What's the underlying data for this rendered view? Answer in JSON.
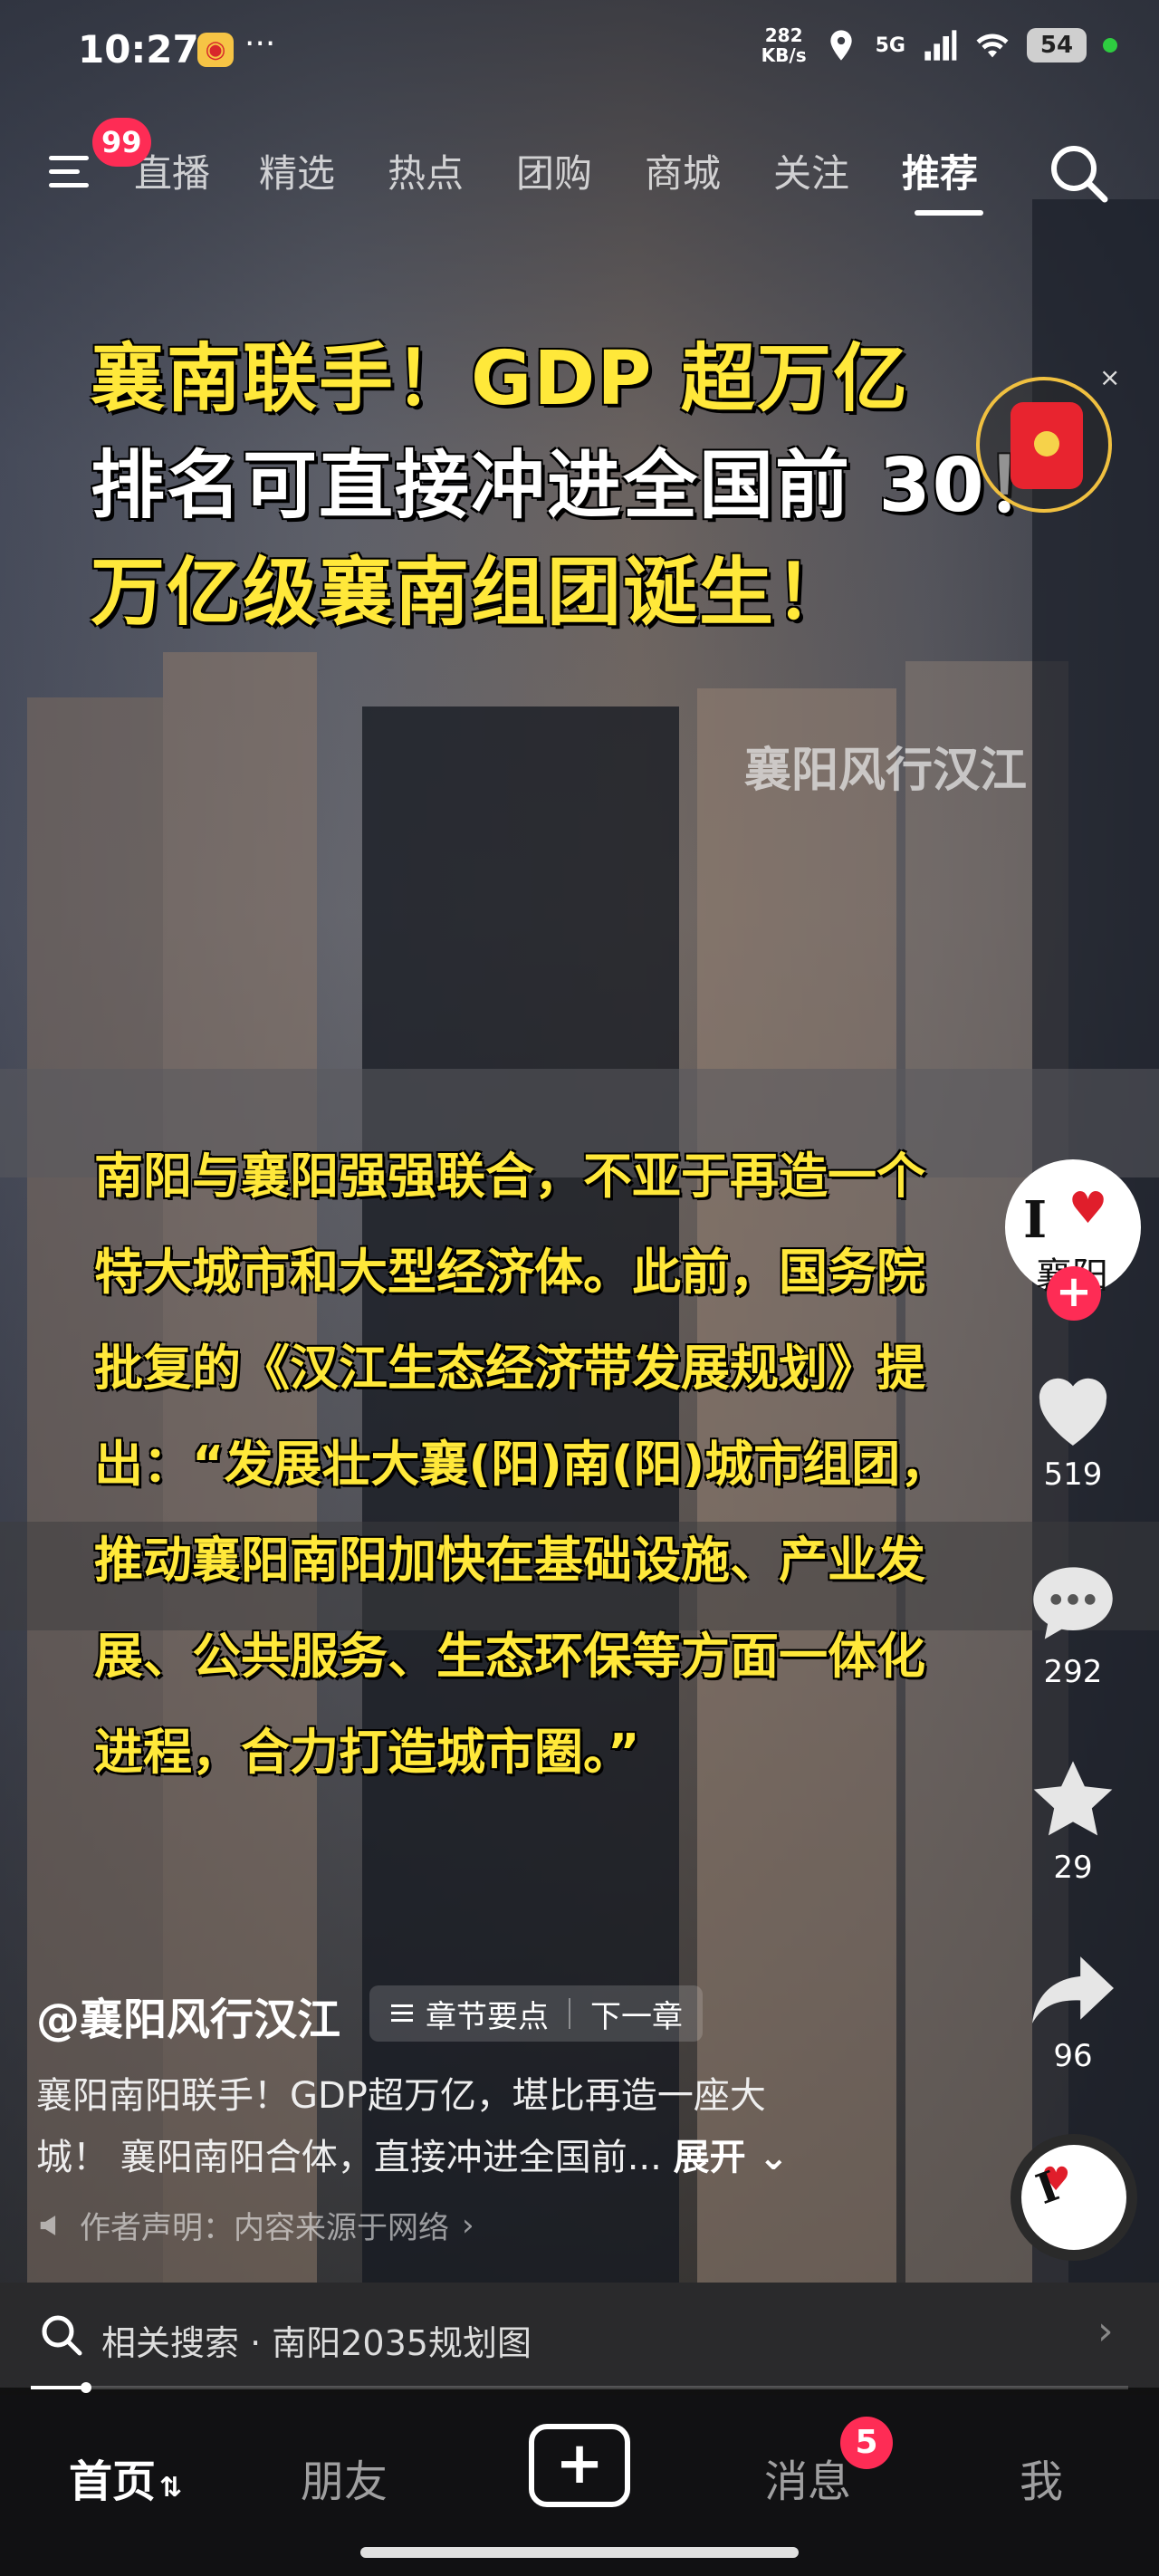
{
  "status_bar": {
    "time": "10:27",
    "dots": "···",
    "net_speed_value": "282",
    "net_speed_unit": "KB/s",
    "signal_label": "5G",
    "battery": "54"
  },
  "top_nav": {
    "menu_badge": "99",
    "tabs": [
      {
        "label": "直播",
        "active": false
      },
      {
        "label": "精选",
        "active": false
      },
      {
        "label": "热点",
        "active": false
      },
      {
        "label": "团购",
        "active": false
      },
      {
        "label": "商城",
        "active": false
      },
      {
        "label": "关注",
        "active": false
      },
      {
        "label": "推荐",
        "active": true
      }
    ]
  },
  "video": {
    "headline_line1": "襄南联手！GDP 超万亿",
    "headline_line2": "排名可直接冲进全国前 30！",
    "headline_line3": "万亿级襄南组团诞生！",
    "watermark": "襄阳风行汉江",
    "red_packet_close": "×",
    "body_lines": [
      "南阳与襄阳强强联合，不亚于再造一个",
      "特大城市和大型经济体。此前，国务院",
      "批复的《汉江生态经济带发展规划》提",
      "出：“发展壮大襄(阳)南(阳)城市组团，",
      "推动襄阳南阳加快在基础设施、产业发",
      "展、公共服务、生态环保等方面一体化",
      "进程，合力打造城市圈。”"
    ]
  },
  "right_rail": {
    "avatar_text": "I",
    "avatar_sub": "襄阳",
    "follow": "+",
    "likes": "519",
    "comments": "292",
    "favorites": "29",
    "shares": "96"
  },
  "info": {
    "author": "@襄阳风行汉江",
    "chapter_label": "章节要点",
    "next_label": "下一章",
    "desc_line1": "襄阳南阳联手！GDP超万亿，堪比再造一座大",
    "desc_line2": "城！ 襄阳南阳合体，直接冲进全国前...",
    "expand": "展开",
    "declare": "作者声明：内容来源于网络"
  },
  "related": {
    "label": "相关搜索 · 南阳2035规划图",
    "progress": 0.05
  },
  "tabbar": {
    "home": "首页",
    "friends": "朋友",
    "add": "+",
    "messages": "消息",
    "messages_badge": "5",
    "me": "我"
  },
  "colors": {
    "accent": "#fe2c55",
    "headline_yellow": "#ffe83a"
  }
}
